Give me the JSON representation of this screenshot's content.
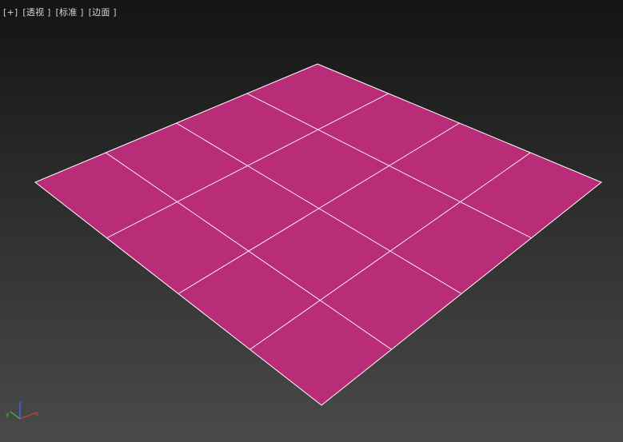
{
  "viewport_menu": {
    "plus": "+",
    "view": "透视",
    "shading": "标准",
    "display": "边面"
  },
  "scene": {
    "object": "plane",
    "segments": {
      "length": 4,
      "width": 4
    },
    "fill_color": "#b82c78",
    "edge_color": "#ffffff",
    "background_top": "#141414",
    "background_bottom": "#4a4a4a"
  },
  "axis_tripod": {
    "x_label": "x",
    "y_label": "y",
    "z_label": "z",
    "x_color": "#e04040",
    "y_color": "#40c040",
    "z_color": "#4a6cff"
  }
}
